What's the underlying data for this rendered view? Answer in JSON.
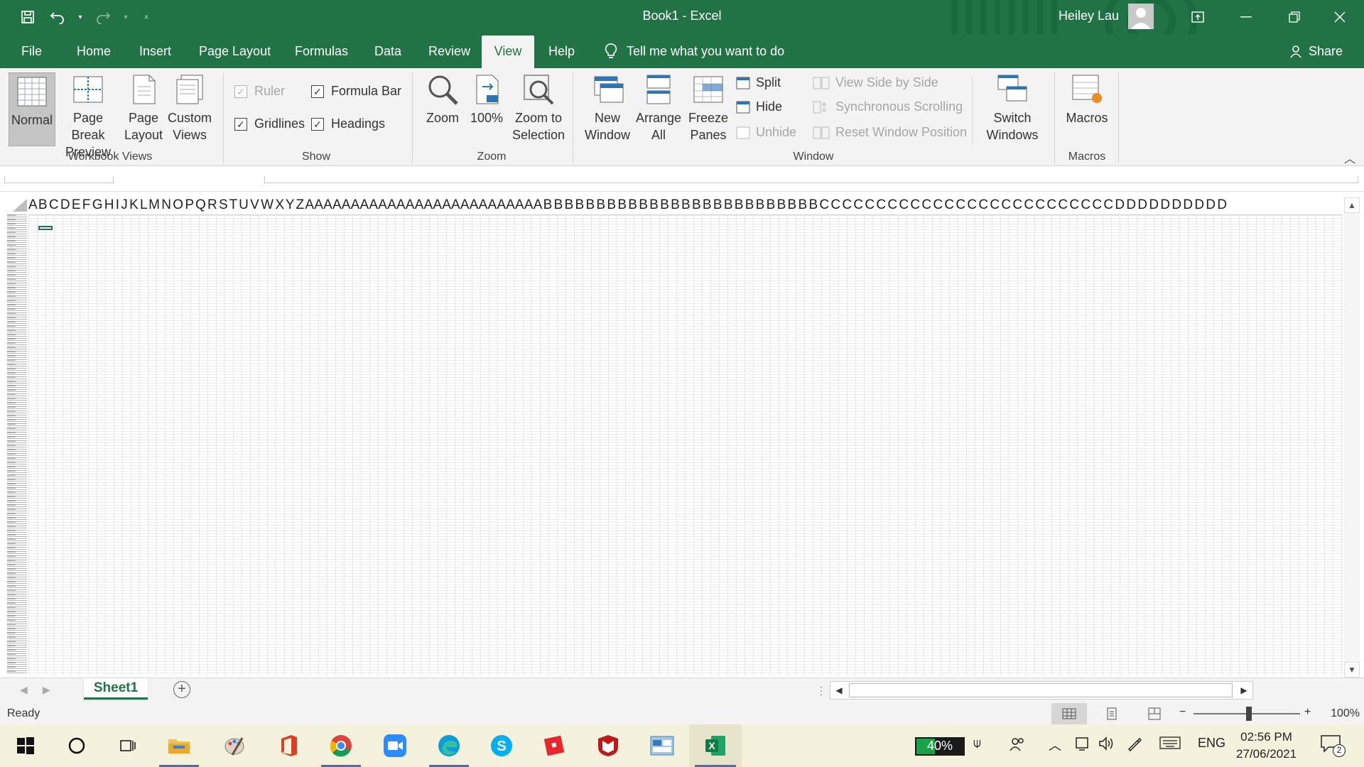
{
  "window": {
    "title": "Book1  -  Excel",
    "user": "Heiley Lau"
  },
  "tabs": [
    {
      "label": "File"
    },
    {
      "label": "Home"
    },
    {
      "label": "Insert"
    },
    {
      "label": "Page Layout"
    },
    {
      "label": "Formulas"
    },
    {
      "label": "Data"
    },
    {
      "label": "Review"
    },
    {
      "label": "View",
      "active": true
    },
    {
      "label": "Help"
    }
  ],
  "tell_me": "Tell me what you want to do",
  "share": "Share",
  "ribbon": {
    "workbook_views": {
      "label": "Workbook Views",
      "normal": "Normal",
      "page_break_1": "Page Break",
      "page_break_2": "Preview",
      "page_layout_1": "Page",
      "page_layout_2": "Layout",
      "custom_views_1": "Custom",
      "custom_views_2": "Views"
    },
    "show": {
      "label": "Show",
      "ruler": "Ruler",
      "formula_bar": "Formula Bar",
      "gridlines": "Gridlines",
      "headings": "Headings"
    },
    "zoom": {
      "label": "Zoom",
      "zoom": "Zoom",
      "hundred": "100%",
      "zoom_sel_1": "Zoom to",
      "zoom_sel_2": "Selection"
    },
    "window": {
      "label": "Window",
      "new_window_1": "New",
      "new_window_2": "Window",
      "arrange_1": "Arrange",
      "arrange_2": "All",
      "freeze_1": "Freeze",
      "freeze_2": "Panes",
      "split": "Split",
      "hide": "Hide",
      "unhide": "Unhide",
      "side_by_side": "View Side by Side",
      "sync_scroll": "Synchronous Scrolling",
      "reset_pos": "Reset Window Position",
      "switch_1": "Switch",
      "switch_2": "Windows"
    },
    "macros": {
      "label": "Macros",
      "macros": "Macros"
    }
  },
  "grid": {
    "column_headers": "A B C D E F G H I J K L M N O P Q R S T U V W X Y Z A A A A A A A A A A A A A A A A A A A A A A A A A A B B B B B B B B B B B B B B B B B B B B B B B B B B C C C C C C C C C C C C C C C C C C C C C C C C C C D D D D D D D D D D"
  },
  "sheet": {
    "name": "Sheet1"
  },
  "status": {
    "ready": "Ready",
    "zoom": "100%"
  },
  "taskbar": {
    "battery": "40%",
    "battery_level": 0.4,
    "lang": "ENG",
    "time": "02:56 PM",
    "date": "27/06/2021",
    "notifications": "2"
  },
  "colors": {
    "excel_green": "#217346"
  }
}
